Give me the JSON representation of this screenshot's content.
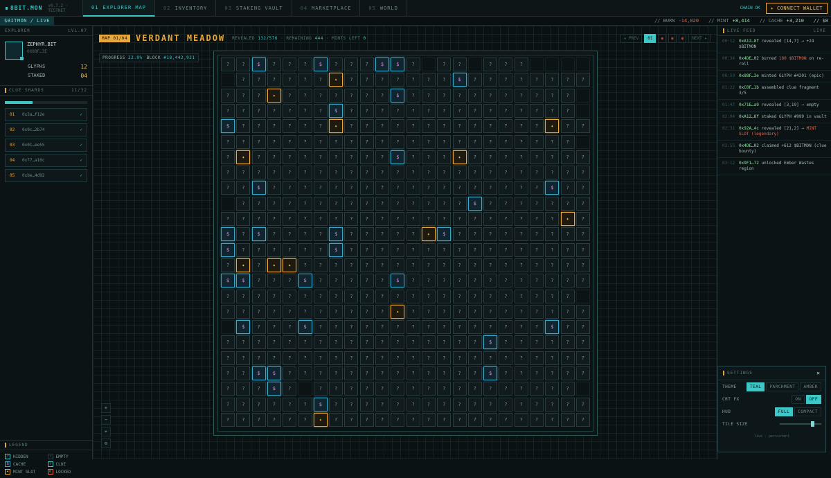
{
  "app": {
    "brand": "8BIT.MON",
    "version": "v0.7.2 · TESTNET",
    "chain_status": "CHAIN OK",
    "connect_label": "✦ CONNECT WALLET"
  },
  "nav": [
    {
      "n": "01",
      "label": "EXPLORER MAP",
      "active": true
    },
    {
      "n": "02",
      "label": "INVENTORY"
    },
    {
      "n": "03",
      "label": "STAKING VAULT"
    },
    {
      "n": "04",
      "label": "MARKETPLACE"
    },
    {
      "n": "05",
      "label": "WORLD"
    }
  ],
  "ticker": {
    "live": "$BITMON / LIVE",
    "burn_label": "// BURN",
    "burn": "-14,820",
    "mint_label": "// MINT",
    "mint": "+8,414",
    "cache_label": "// CACHE",
    "cache": "+3,210",
    "extra": "// $B"
  },
  "explorer": {
    "title": "EXPLORER",
    "level": "LVL.07",
    "name": "ZEPHYR.BIT",
    "addr": "0X88F…3E",
    "glyphs_label": "GLYPHS",
    "glyphs": "12",
    "staked_label": "STAKED",
    "staked": "04"
  },
  "clue_shards": {
    "title": "CLUE SHARDS",
    "count": "11/32",
    "progress": 0.34,
    "items": [
      {
        "no": "01",
        "addr": "0x3a…f12e"
      },
      {
        "no": "02",
        "addr": "0x9c…2b74"
      },
      {
        "no": "03",
        "addr": "0x01…ee55"
      },
      {
        "no": "04",
        "addr": "0x77…a10c"
      },
      {
        "no": "05",
        "addr": "0xbe…4d92"
      }
    ]
  },
  "legend": {
    "title": "LEGEND",
    "items": [
      {
        "sym": "?",
        "label": "HIDDEN"
      },
      {
        "sym": "·",
        "label": "EMPTY"
      },
      {
        "sym": "$",
        "label": "CACHE"
      },
      {
        "sym": "?",
        "label": "CLUE"
      },
      {
        "sym": "✦",
        "label": "MINT SLOT"
      },
      {
        "sym": "⊘",
        "label": "LOCKED"
      }
    ]
  },
  "map": {
    "badge": "MAP 01/04",
    "title": "VERDANT MEADOW",
    "revealed_label": "REVEALED",
    "revealed": "132/576",
    "remaining_label": "· REMAINING",
    "remaining": "444",
    "mints_label": "· MINTS LEFT",
    "mints": "0",
    "prev": "◂ PREV",
    "page": "01",
    "next": "NEXT ▸",
    "progress_label": "PROGRESS",
    "progress": "22.9%",
    "block_label": "BLOCK",
    "block": "#18,442,921",
    "rows": [
      "??$???$???$$?.??.???.",
      ".??????+???????$?????????",
      "???+???????$???????????",
      "???????$???????????????",
      "$??????+?????????????+????",
      "???????????????????????.?",
      "?+?????????$???+???????????",
      "???????????????????????????",
      "??$??????????????????$???",
      ".???????????????$????????",
      "??????????????????????+??",
      "$?$????$?????+$?????????",
      "$??????$?????????????????",
      "?+?++???????????????????",
      "$$???$?????$?????????????",
      "???????????????????????",
      "???????????+?????????????",
      ".$???$???????????????$???",
      "?????????????????$??????",
      "?????????????????????????",
      "??$$?????????????$???????",
      "???$?.?????????????????",
      "??????$??????????????????",
      "??????+?????????????????"
    ]
  },
  "zoom": [
    "+",
    "−",
    "⌖",
    "⊙"
  ],
  "feed": {
    "title": "LIVE FEED",
    "live": "LIVE",
    "items": [
      {
        "t": "00:12",
        "a": "0xA12…8f",
        "txt": "revealed [14,7] → +24 $BITMON"
      },
      {
        "t": "00:34",
        "a": "0x4DE…02",
        "txt": "burned",
        "x": "180 $BITMON",
        "tail": "on re-roll"
      },
      {
        "t": "00:59",
        "a": "0x88F…3e",
        "txt": "minted GLYPH #4201 (epic)"
      },
      {
        "t": "01:22",
        "a": "0xC0F…1b",
        "txt": "assembled clue fragment 3/5"
      },
      {
        "t": "01:47",
        "a": "0x71E…a9",
        "txt": "revealed [3,19] → empty"
      },
      {
        "t": "02:04",
        "a": "0xA12…8f",
        "txt": "staked GLYPH #999 in vault"
      },
      {
        "t": "02:31",
        "a": "0x92A…4c",
        "txt": "revealed [21,2] →",
        "x": "MINT SLOT (legendary)"
      },
      {
        "t": "02:55",
        "a": "0x4DE…02",
        "txt": "claimed +612 $BITMON (clue bounty)"
      },
      {
        "t": "03:12",
        "a": "0x9F1…72",
        "txt": "unlocked Ember Wastes region"
      }
    ]
  },
  "settings": {
    "title": "SETTINGS",
    "close": "✕",
    "theme_label": "THEME",
    "themes": [
      "TEAL",
      "PARCHMENT",
      "AMBER"
    ],
    "theme_active": 0,
    "crt_label": "CRT FX",
    "crt": [
      "ON",
      "OFF"
    ],
    "crt_active": 1,
    "hud_label": "HUD",
    "hud": [
      "FULL",
      "COMPACT"
    ],
    "hud_active": 0,
    "tile_label": "TILE SIZE",
    "tile_size": 0.75,
    "footer": "live · persistent"
  },
  "colors": {
    "accent": "#3fc6c6",
    "amber": "#e8a73a",
    "pink": "#e38ad8",
    "red": "#e06650",
    "green": "#8fe0a0"
  }
}
